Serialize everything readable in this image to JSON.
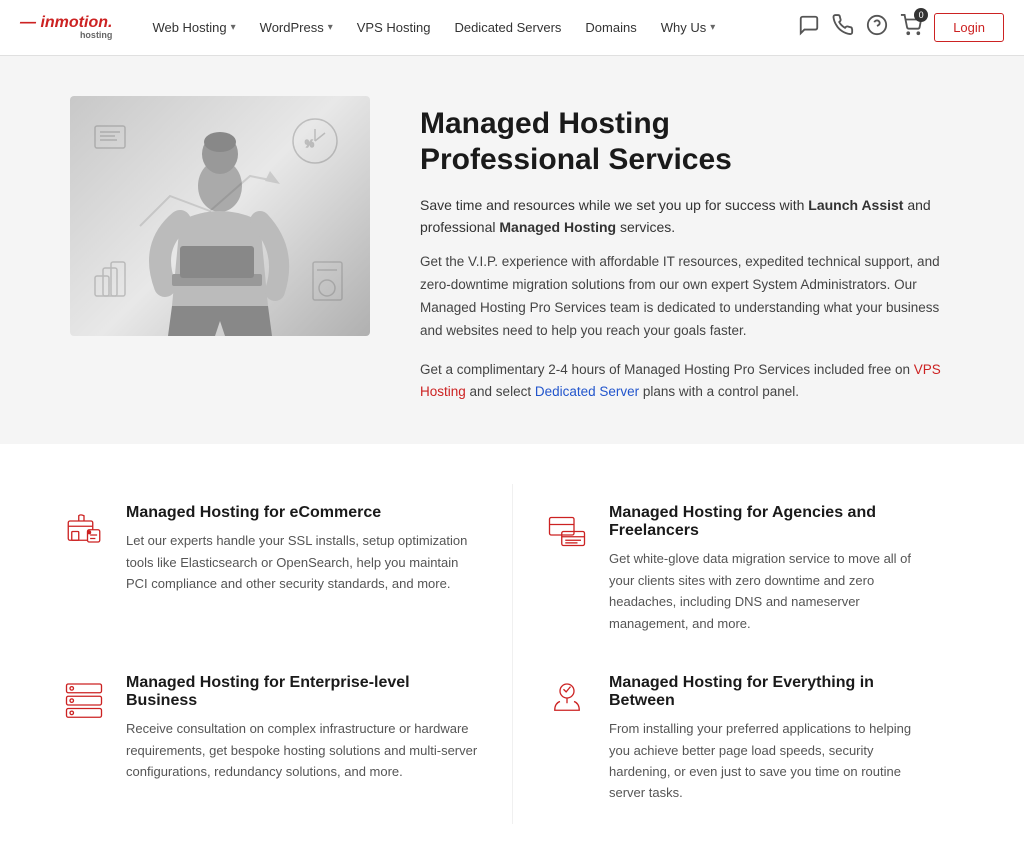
{
  "header": {
    "logo_main": "inmotion.",
    "logo_sub": "hosting",
    "nav_items": [
      {
        "label": "Web Hosting",
        "has_arrow": true
      },
      {
        "label": "WordPress",
        "has_arrow": true
      },
      {
        "label": "VPS Hosting",
        "has_arrow": false
      },
      {
        "label": "Dedicated Servers",
        "has_arrow": false
      },
      {
        "label": "Domains",
        "has_arrow": false
      },
      {
        "label": "Why Us",
        "has_arrow": true
      }
    ],
    "login_label": "Login",
    "cart_count": "0"
  },
  "hero": {
    "title_line1": "Managed Hosting",
    "title_line2": "Professional Services",
    "subtitle": "Save time and resources while we set you up for success with Launch Assist and professional Managed Hosting services.",
    "desc": "Get the V.I.P. experience with affordable IT resources, expedited technical support, and zero-downtime migration solutions from our own expert System Administrators. Our Managed Hosting Pro Services team is dedicated to understanding what your business and websites need to help you reach your goals faster.",
    "footer_start": "Get a complimentary 2-4 hours of Managed Hosting Pro Services included free on ",
    "footer_link1": "VPS Hosting",
    "footer_middle": " and select ",
    "footer_link2": "Dedicated Server",
    "footer_end": " plans with a control panel.",
    "bold_launch": "Launch Assist",
    "bold_managed": "Managed Hosting"
  },
  "features": [
    {
      "id": "ecommerce",
      "title": "Managed Hosting for eCommerce",
      "desc": "Let our experts handle your SSL installs, setup optimization tools like Elasticsearch or OpenSearch, help you maintain PCI compliance and other security standards, and more."
    },
    {
      "id": "agencies",
      "title": "Managed Hosting for Agencies and Freelancers",
      "desc": "Get white-glove data migration service to move all of your clients sites with zero downtime and zero headaches, including DNS and nameserver management, and more."
    },
    {
      "id": "enterprise",
      "title": "Managed Hosting for Enterprise-level Business",
      "desc": "Receive consultation on complex infrastructure or hardware requirements, get bespoke hosting solutions and multi-server configurations, redundancy solutions, and more."
    },
    {
      "id": "everything",
      "title": "Managed Hosting for Everything in Between",
      "desc": "From installing your preferred applications to helping you achieve better page load speeds, security hardening, or even just to save you time on routine server tasks."
    }
  ]
}
